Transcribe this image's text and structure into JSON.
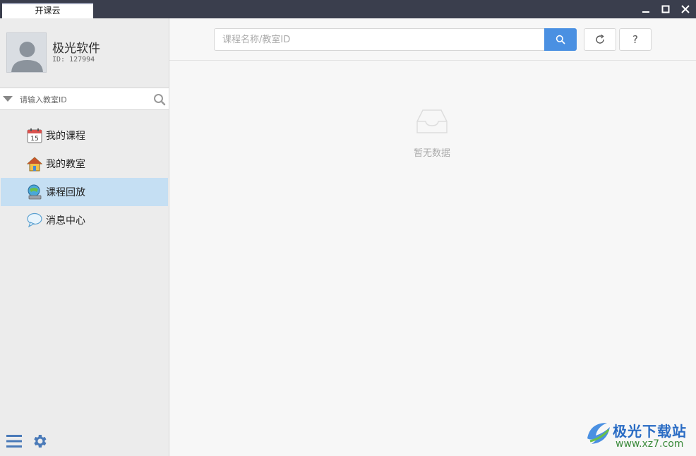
{
  "titlebar": {
    "tab_label": "开课云"
  },
  "user": {
    "name": "极光软件",
    "id_text": "ID: 127994"
  },
  "room_search": {
    "placeholder": "请输入教室ID"
  },
  "nav": {
    "items": [
      {
        "label": "我的课程",
        "icon": "calendar-icon",
        "active": false
      },
      {
        "label": "我的教室",
        "icon": "house-icon",
        "active": false
      },
      {
        "label": "课程回放",
        "icon": "playback-icon",
        "active": true
      },
      {
        "label": "消息中心",
        "icon": "speech-bubble-icon",
        "active": false
      }
    ]
  },
  "search": {
    "placeholder": "课程名称/教室ID"
  },
  "toolbar": {
    "help_label": "?"
  },
  "empty_state": {
    "text": "暂无数据"
  },
  "watermark": {
    "brand": "极光下载站",
    "url": "www.xz7.com"
  },
  "colors": {
    "titlebar": "#3a3e4d",
    "accent": "#4a90e2",
    "active_nav": "#c5dff3",
    "sidebar": "#ececec"
  },
  "calendar_day": "15"
}
